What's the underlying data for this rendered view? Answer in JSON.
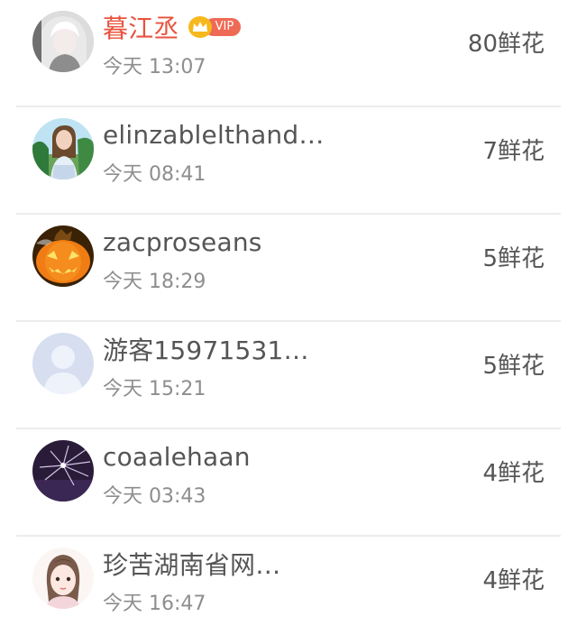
{
  "rank_list": {
    "rows": [
      {
        "name": "暮江丞",
        "vip": true,
        "vip_label": "VIP",
        "time": "今天 13:07",
        "flowers": "80鲜花",
        "avatar": "girl-white-hair-avatar"
      },
      {
        "name": "elinzablelthand…",
        "vip": false,
        "time": "今天 08:41",
        "flowers": "7鲜花",
        "avatar": "girl-outdoor-avatar"
      },
      {
        "name": "zacproseans",
        "vip": false,
        "time": "今天 18:29",
        "flowers": "5鲜花",
        "avatar": "pumpkin-avatar"
      },
      {
        "name": "游客15971531…",
        "vip": false,
        "time": "今天 15:21",
        "flowers": "5鲜花",
        "avatar": "default-user-avatar"
      },
      {
        "name": "coaalehaan",
        "vip": false,
        "time": "今天 03:43",
        "flowers": "4鲜花",
        "avatar": "purple-firework-avatar"
      },
      {
        "name": "珍苦湖南省网…",
        "vip": false,
        "time": "今天 16:47",
        "flowers": "4鲜花",
        "avatar": "cartoon-girl-avatar"
      }
    ],
    "colors": {
      "vip_name": "#e8533e",
      "vip_badge": "#ef6a55",
      "crown": "#f6b81c",
      "name": "#555555",
      "time": "#8e8e8e",
      "divider": "#ececec"
    }
  }
}
